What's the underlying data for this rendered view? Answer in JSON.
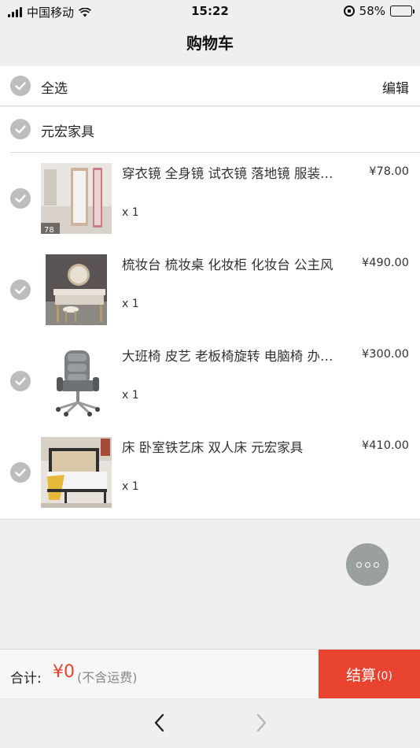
{
  "status_bar": {
    "carrier": "中国移动",
    "time": "15:22",
    "battery": "58%",
    "battery_level": 0.58
  },
  "nav": {
    "title": "购物车"
  },
  "select_all": {
    "label": "全选",
    "edit": "编辑"
  },
  "shop": {
    "name": "元宏家具"
  },
  "items": [
    {
      "title": "穿衣镜 全身镜 试衣镜 落地镜 服装店镜子",
      "price": "¥78.00",
      "qty": "x 1",
      "thumb_badge": "78",
      "thumb_icon": "mirror-image"
    },
    {
      "title": "梳妆台 梳妆桌 化妆柜 化妆台 公主风",
      "price": "¥490.00",
      "qty": "x 1",
      "thumb_icon": "dresser-image"
    },
    {
      "title": "大班椅 皮艺 老板椅旋转 电脑椅 办公椅",
      "price": "¥300.00",
      "qty": "x 1",
      "thumb_icon": "chair-image"
    },
    {
      "title": "床 卧室铁艺床 双人床 元宏家具",
      "price": "¥410.00",
      "qty": "x 1",
      "thumb_icon": "bed-image"
    }
  ],
  "summary": {
    "label": "合计:",
    "amount": "¥0",
    "note": "(不含运费)",
    "checkout_label": "结算",
    "checkout_count": "(0)"
  },
  "colors": {
    "accent": "#e8432f",
    "check": "#bdbdbd",
    "background": "#efefef"
  },
  "icons": {
    "fab": "more-icon",
    "back": "chevron-left-icon",
    "forward": "chevron-right-icon"
  }
}
